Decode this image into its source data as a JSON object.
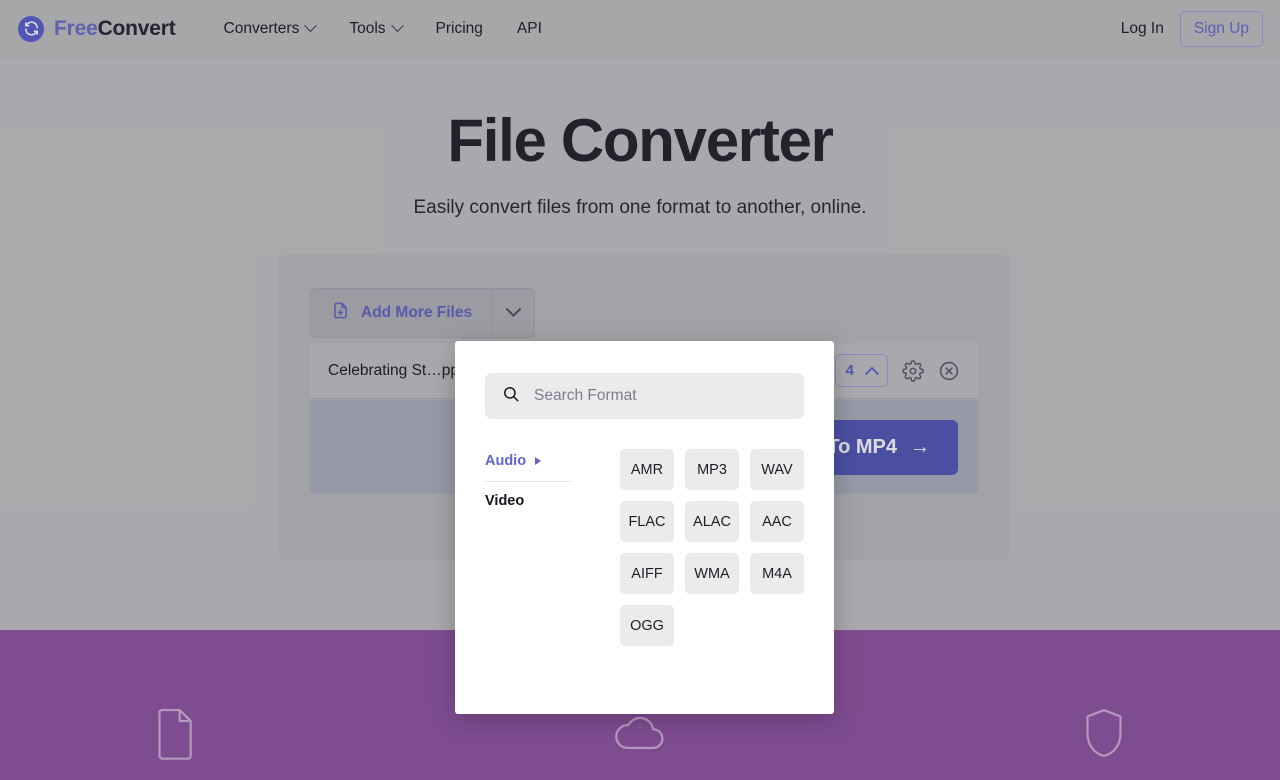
{
  "header": {
    "brand": {
      "free": "Free",
      "convert": "Convert",
      "icon": "refresh-circle-icon"
    },
    "nav": [
      {
        "label": "Converters",
        "has_caret": true
      },
      {
        "label": "Tools",
        "has_caret": true
      },
      {
        "label": "Pricing",
        "has_caret": false
      },
      {
        "label": "API",
        "has_caret": false
      }
    ],
    "login_label": "Log In",
    "signup_label": "Sign Up"
  },
  "hero": {
    "title": "File Converter",
    "subtitle": "Easily convert files from one format to another, online."
  },
  "converter": {
    "add_more_files_label": "Add More Files",
    "file_name": "Celebrating St…pp",
    "output_format": "4",
    "convert_button_label": "To MP4",
    "convert_button_arrow": "→"
  },
  "modal": {
    "search_placeholder": "Search Format",
    "search_value": "",
    "categories": [
      {
        "label": "Audio",
        "active": true
      },
      {
        "label": "Video",
        "active": false
      }
    ],
    "formats": [
      "AMR",
      "MP3",
      "WAV",
      "FLAC",
      "ALAC",
      "AAC",
      "AIFF",
      "WMA",
      "M4A",
      "OGG"
    ]
  },
  "footer_band": {
    "icons": [
      "file-document-icon",
      "cloud-icon",
      "shield-icon"
    ]
  },
  "colors": {
    "accent_indigo": "#6266c9",
    "convert_button": "#5257b8",
    "band_purple": "#9154a4",
    "page_background": "#c3c3c5"
  }
}
